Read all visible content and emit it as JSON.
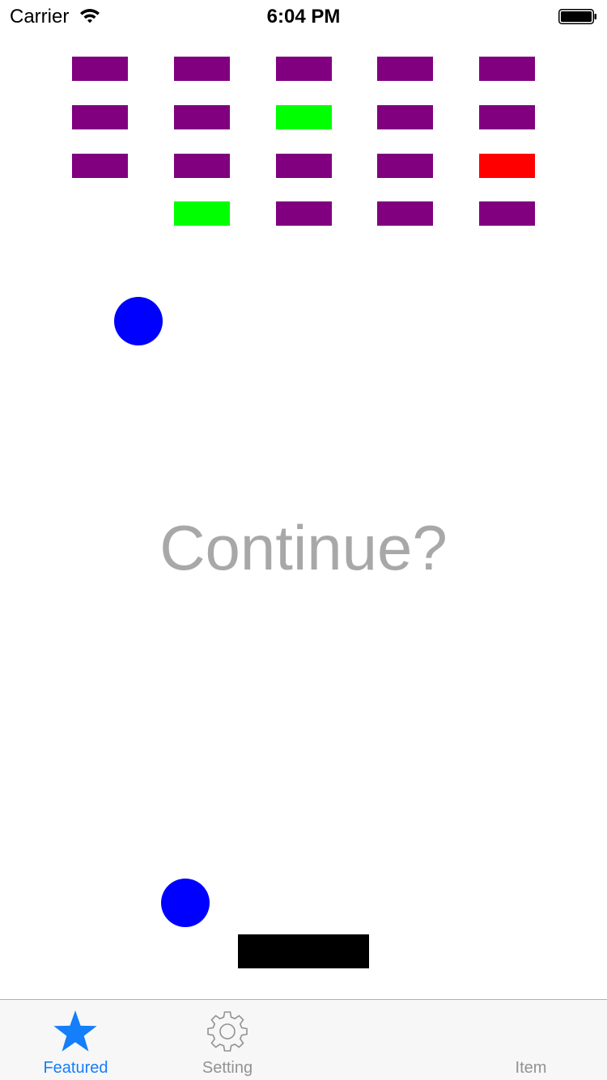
{
  "status_bar": {
    "carrier": "Carrier",
    "time": "6:04 PM"
  },
  "game": {
    "bricks": [
      {
        "row": 0,
        "col": 0,
        "color": "#800080"
      },
      {
        "row": 0,
        "col": 1,
        "color": "#800080"
      },
      {
        "row": 0,
        "col": 2,
        "color": "#800080"
      },
      {
        "row": 0,
        "col": 3,
        "color": "#800080"
      },
      {
        "row": 0,
        "col": 4,
        "color": "#800080"
      },
      {
        "row": 1,
        "col": 0,
        "color": "#800080"
      },
      {
        "row": 1,
        "col": 1,
        "color": "#800080"
      },
      {
        "row": 1,
        "col": 2,
        "color": "#00ff00"
      },
      {
        "row": 1,
        "col": 3,
        "color": "#800080"
      },
      {
        "row": 1,
        "col": 4,
        "color": "#800080"
      },
      {
        "row": 2,
        "col": 0,
        "color": "#800080"
      },
      {
        "row": 2,
        "col": 1,
        "color": "#800080"
      },
      {
        "row": 2,
        "col": 2,
        "color": "#800080"
      },
      {
        "row": 2,
        "col": 3,
        "color": "#800080"
      },
      {
        "row": 2,
        "col": 4,
        "color": "#ff0000"
      },
      {
        "row": 3,
        "col": 1,
        "color": "#00ff00"
      },
      {
        "row": 3,
        "col": 2,
        "color": "#800080"
      },
      {
        "row": 3,
        "col": 3,
        "color": "#800080"
      },
      {
        "row": 3,
        "col": 4,
        "color": "#800080"
      }
    ],
    "ball_color": "#0000ff",
    "paddle_color": "#000000",
    "prompt": "Continue?"
  },
  "tab_bar": {
    "active_color": "#147efb",
    "inactive_color": "#929292",
    "tabs": [
      {
        "label": "Featured",
        "icon": "star-icon",
        "active": true
      },
      {
        "label": "Setting",
        "icon": "gear-icon",
        "active": false
      },
      {
        "label": "Item",
        "icon": "",
        "active": false
      }
    ]
  }
}
